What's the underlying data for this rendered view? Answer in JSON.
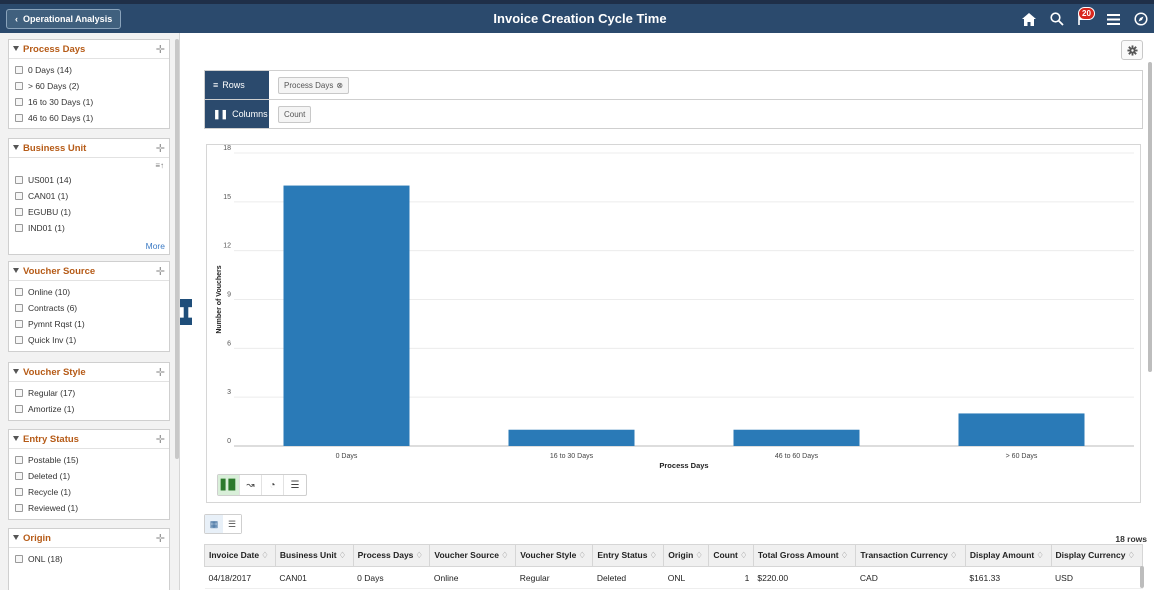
{
  "header": {
    "back_label": "Operational Analysis",
    "title": "Invoice Creation Cycle Time",
    "notification_count": "20"
  },
  "facets": [
    {
      "title": "Process Days",
      "items": [
        "0 Days (14)",
        "> 60 Days (2)",
        "16 to 30 Days (1)",
        "46 to 60 Days (1)"
      ]
    },
    {
      "title": "Business Unit",
      "items": [
        "US001 (14)",
        "CAN01 (1)",
        "EGUBU (1)",
        "IND01 (1)"
      ],
      "more_label": "More"
    },
    {
      "title": "Voucher Source",
      "items": [
        "Online (10)",
        "Contracts (6)",
        "Pymnt Rqst (1)",
        "Quick Inv (1)"
      ]
    },
    {
      "title": "Voucher Style",
      "items": [
        "Regular (17)",
        "Amortize (1)"
      ]
    },
    {
      "title": "Entry Status",
      "items": [
        "Postable (15)",
        "Deleted (1)",
        "Recycle (1)",
        "Reviewed (1)"
      ]
    },
    {
      "title": "Origin",
      "items": [
        "ONL (18)"
      ]
    }
  ],
  "pivot": {
    "rows_label": "Rows",
    "rows_chip": "Process Days",
    "columns_label": "Columns",
    "columns_chip": "Count"
  },
  "chart_data": {
    "type": "bar",
    "categories": [
      "0 Days",
      "16 to 30 Days",
      "46 to 60 Days",
      "> 60 Days"
    ],
    "values": [
      16,
      1,
      1,
      2
    ],
    "xlabel": "Process Days",
    "ylabel": "Number of Vouchers",
    "ylim": [
      0,
      18
    ],
    "yticks": [
      0,
      3,
      6,
      9,
      12,
      15,
      18
    ],
    "grid": true,
    "bar_color": "#2a7ab7"
  },
  "table": {
    "row_count": "18 rows",
    "columns": [
      "Invoice Date",
      "Business Unit",
      "Process Days",
      "Voucher Source",
      "Voucher Style",
      "Entry Status",
      "Origin",
      "Count",
      "Total Gross Amount",
      "Transaction Currency",
      "Display Amount",
      "Display Currency"
    ],
    "rows": [
      [
        "04/18/2017",
        "CAN01",
        "0 Days",
        "Online",
        "Regular",
        "Deleted",
        "ONL",
        "1",
        "$220.00",
        "CAD",
        "$161.33",
        "USD"
      ]
    ]
  }
}
